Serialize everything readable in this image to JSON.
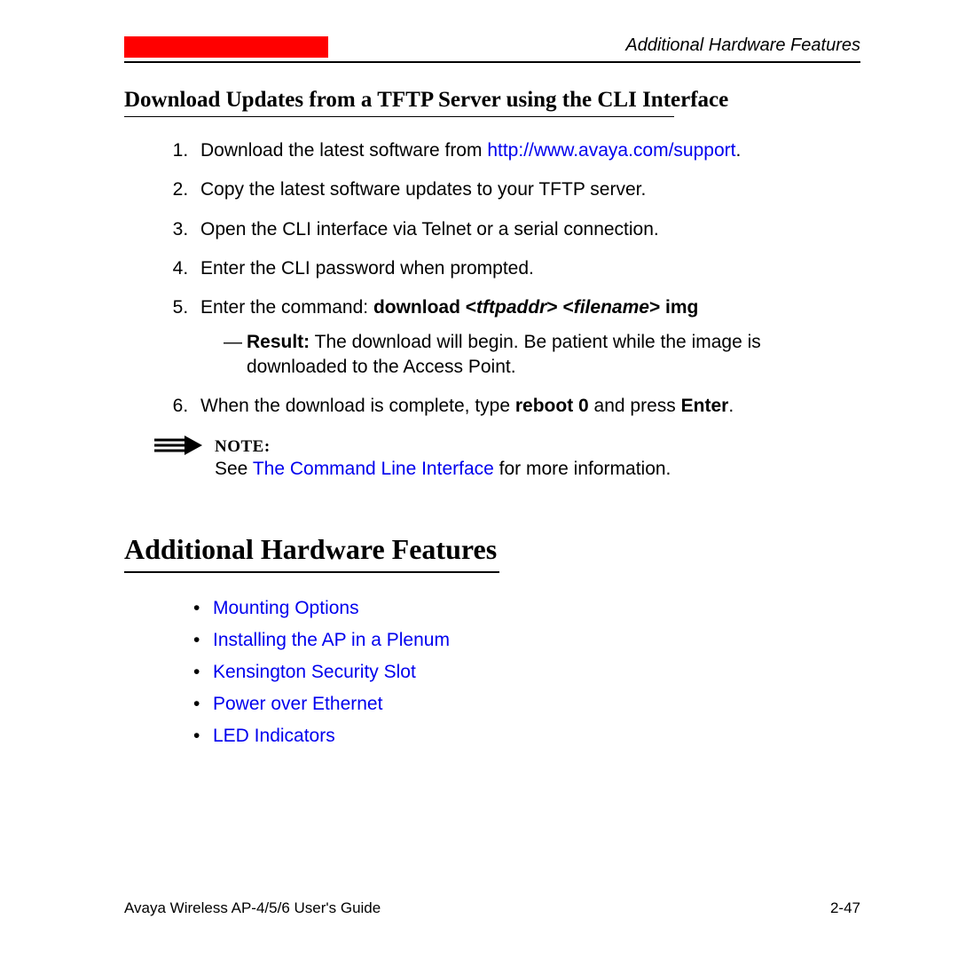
{
  "header": {
    "running_title": "Additional Hardware Features"
  },
  "section": {
    "title": "Download Updates from a TFTP Server using the CLI Interface"
  },
  "steps": {
    "s1_pre": "Download the latest software from ",
    "s1_link": "http://www.avaya.com/support",
    "s1_post": ".",
    "s2": "Copy the latest software updates to your TFTP server.",
    "s3": "Open the CLI interface via Telnet or a serial connection.",
    "s4": "Enter the CLI password when prompted.",
    "s5_pre": "Enter the command: ",
    "s5_cmd1": "download <",
    "s5_var1": "tftpaddr",
    "s5_mid": "> <",
    "s5_var2": "filename",
    "s5_cmd2": "> img",
    "s5_result_label": "Result:",
    "s5_result_text": " The download will begin. Be patient while the image is downloaded to the Access Point.",
    "s6_pre": "When the download is complete, type ",
    "s6_b1": "reboot 0",
    "s6_mid": " and press ",
    "s6_b2": "Enter",
    "s6_post": "."
  },
  "note": {
    "label": "NOTE:",
    "pre": "See ",
    "link": "The Command Line Interface",
    "post": " for more information."
  },
  "main": {
    "heading": "Additional Hardware Features"
  },
  "bullets": {
    "b1": "Mounting Options",
    "b2": "Installing the AP in a Plenum",
    "b3": "Kensington Security Slot",
    "b4": "Power over Ethernet",
    "b5": "LED Indicators"
  },
  "footer": {
    "left": "Avaya Wireless AP-4/5/6 User's Guide",
    "right": "2-47"
  }
}
